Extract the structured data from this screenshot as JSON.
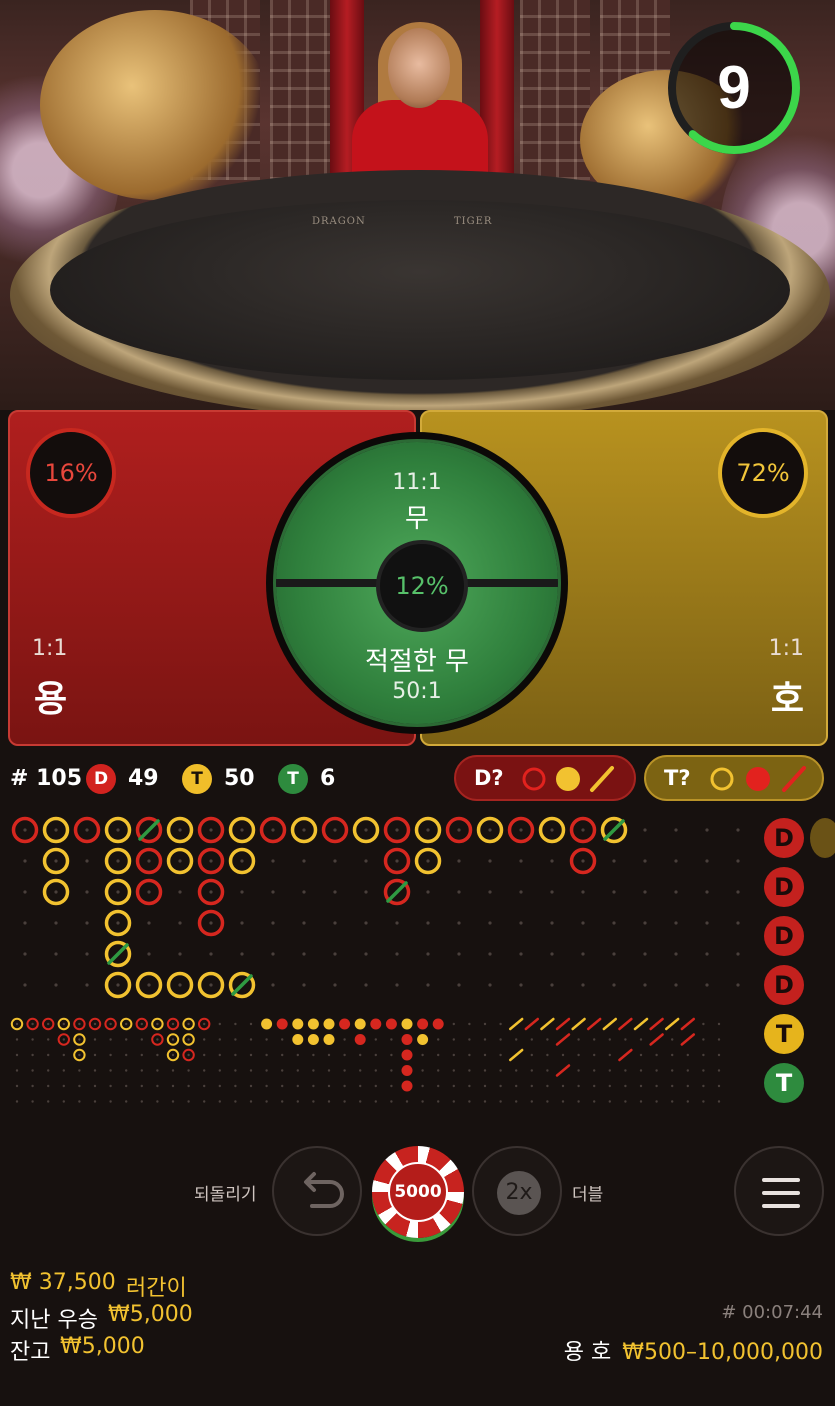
{
  "timer": {
    "value": "9"
  },
  "table_print": {
    "left": "DRAGON",
    "right": "TIGER"
  },
  "bet": {
    "dragon": {
      "percent": "16%",
      "odds": "1:1",
      "label": "용"
    },
    "tiger": {
      "percent": "72%",
      "odds": "1:1",
      "label": "호"
    },
    "tie": {
      "odds": "11:1",
      "label": "무",
      "percent": "12%"
    },
    "suited_tie": {
      "label": "적절한 무",
      "odds": "50:1"
    }
  },
  "stats": {
    "round": "# 105",
    "dragon_badge": "D",
    "dragon_count": "49",
    "tiger_badge": "T",
    "tiger_count": "50",
    "tie_badge": "T",
    "tie_count": "6",
    "dragon_predict": "D?",
    "tiger_predict": "T?"
  },
  "roadmap_side": [
    "D",
    "D",
    "D",
    "D",
    "T",
    "T"
  ],
  "controls": {
    "undo_label": "되돌리기",
    "chip_value": "5000",
    "double_icon": "2x",
    "double_label": "더블"
  },
  "footer": {
    "running_bet_amount": "₩ 37,500",
    "running_bet_label": "러간이",
    "last_win_label": "지난 우승",
    "last_win_amount": "₩5,000",
    "balance_label": "잔고",
    "balance_amount": "₩5,000",
    "game_id": "# 00:07:44",
    "limits_label": "용 호",
    "limits_amount": "₩500–10,000,000"
  },
  "colors": {
    "dragon": "#c4211e",
    "tiger": "#e6b41c",
    "tie": "#2e8b3e"
  }
}
